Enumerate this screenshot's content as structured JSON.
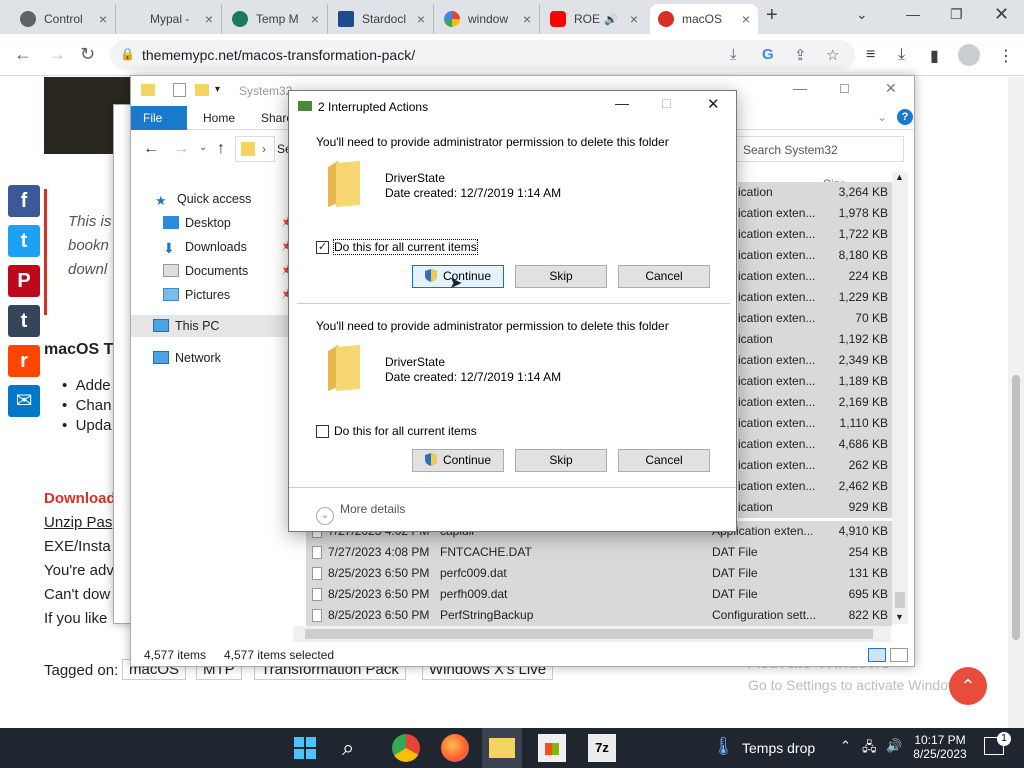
{
  "browser": {
    "tabs": [
      {
        "label": "Control"
      },
      {
        "label": "Mypal -"
      },
      {
        "label": "Temp M"
      },
      {
        "label": "Stardocl"
      },
      {
        "label": "window"
      },
      {
        "label": "ROE"
      },
      {
        "label": "macOS"
      }
    ],
    "url": "thememypc.net/macos-transformation-pack/"
  },
  "webpage": {
    "intro_lines": [
      "This is",
      "bookn",
      "downl"
    ],
    "section_heading": "macOS Tr",
    "bullets": [
      "Adde",
      "Chan",
      "Upda"
    ],
    "download_link": "Download",
    "unzip_text": "Unzip Pas",
    "para_lines": [
      "EXE/Insta",
      "You're adv",
      "Can't dow",
      "If you like"
    ],
    "tagged_label": "Tagged on:",
    "tags": [
      "macOS",
      "MTP",
      "Transformation Pack",
      "Windows X's Live"
    ],
    "activate_title": "Activate Windows",
    "activate_sub": "Go to Settings to activate Windows."
  },
  "share_buttons": [
    {
      "icon": "facebook-icon",
      "glyph": "f",
      "color": "#3b5998"
    },
    {
      "icon": "twitter-icon",
      "glyph": "t",
      "color": "#1da1f2"
    },
    {
      "icon": "pinterest-icon",
      "glyph": "P",
      "color": "#bd081c"
    },
    {
      "icon": "tumblr-icon",
      "glyph": "t",
      "color": "#35465c"
    },
    {
      "icon": "reddit-icon",
      "glyph": "r",
      "color": "#ff4500"
    },
    {
      "icon": "email-icon",
      "glyph": "✉",
      "color": "#0077c7"
    }
  ],
  "explorer": {
    "title": "System32",
    "ribbon_tabs": [
      "File",
      "Home",
      "Share"
    ],
    "search_placeholder": "Search System32",
    "breadcrumb_stub": "Se",
    "nav": [
      {
        "label": "Quick access",
        "icon": "star-icon"
      },
      {
        "label": "Desktop",
        "icon": "desktop-icon",
        "pinned": true
      },
      {
        "label": "Downloads",
        "icon": "download-icon",
        "pinned": true
      },
      {
        "label": "Documents",
        "icon": "documents-icon",
        "pinned": true
      },
      {
        "label": "Pictures",
        "icon": "pictures-icon",
        "pinned": true
      },
      {
        "label": "This PC",
        "icon": "computer-icon"
      },
      {
        "label": "Network",
        "icon": "network-icon"
      }
    ],
    "size_header": "Size",
    "right_rows": [
      {
        "type": "ication",
        "size": "3,264 KB"
      },
      {
        "type": "ication exten...",
        "size": "1,978 KB"
      },
      {
        "type": "ication exten...",
        "size": "1,722 KB"
      },
      {
        "type": "ication exten...",
        "size": "8,180 KB"
      },
      {
        "type": "ication exten...",
        "size": "224 KB"
      },
      {
        "type": "ication exten...",
        "size": "1,229 KB"
      },
      {
        "type": "ication exten...",
        "size": "70 KB"
      },
      {
        "type": "ication",
        "size": "1,192 KB"
      },
      {
        "type": "ication exten...",
        "size": "2,349 KB"
      },
      {
        "type": "ication exten...",
        "size": "1,189 KB"
      },
      {
        "type": "ication exten...",
        "size": "2,169 KB"
      },
      {
        "type": "ication exten...",
        "size": "1,110 KB"
      },
      {
        "type": "ication exten...",
        "size": "4,686 KB"
      },
      {
        "type": "ication exten...",
        "size": "262 KB"
      },
      {
        "type": "ication exten...",
        "size": "2,462 KB"
      },
      {
        "type": "ication",
        "size": "929 KB"
      }
    ],
    "bottom_rows": [
      {
        "date": "7/27/2023 4:02 PM",
        "name": "capiuii",
        "type": "Application exten...",
        "size": "4,910 KB"
      },
      {
        "date": "7/27/2023 4:08 PM",
        "name": "FNTCACHE.DAT",
        "type": "DAT File",
        "size": "254 KB"
      },
      {
        "date": "8/25/2023 6:50 PM",
        "name": "perfc009.dat",
        "type": "DAT File",
        "size": "131 KB"
      },
      {
        "date": "8/25/2023 6:50 PM",
        "name": "perfh009.dat",
        "type": "DAT File",
        "size": "695 KB"
      },
      {
        "date": "8/25/2023 6:50 PM",
        "name": "PerfStringBackup",
        "type": "Configuration sett...",
        "size": "822 KB"
      }
    ],
    "status_items": "4,577 items",
    "status_selected": "4,577 items selected"
  },
  "dialog": {
    "title": "2 Interrupted Actions",
    "sections": [
      {
        "message": "You'll need to provide administrator permission to delete this folder",
        "folder_name": "DriverState",
        "date_created": "Date created: 12/7/2019 1:14 AM",
        "checkbox_label": "Do this for all current items",
        "checked": true
      },
      {
        "message": "You'll need to provide administrator permission to delete this folder",
        "folder_name": "DriverState",
        "date_created": "Date created: 12/7/2019 1:14 AM",
        "checkbox_label": "Do this for all current items",
        "checked": false
      }
    ],
    "continue_label": "Continue",
    "skip_label": "Skip",
    "cancel_label": "Cancel",
    "more_details": "More details"
  },
  "taskbar": {
    "weather": "Temps drop",
    "time": "10:17 PM",
    "date": "8/25/2023",
    "notification_count": "1"
  }
}
